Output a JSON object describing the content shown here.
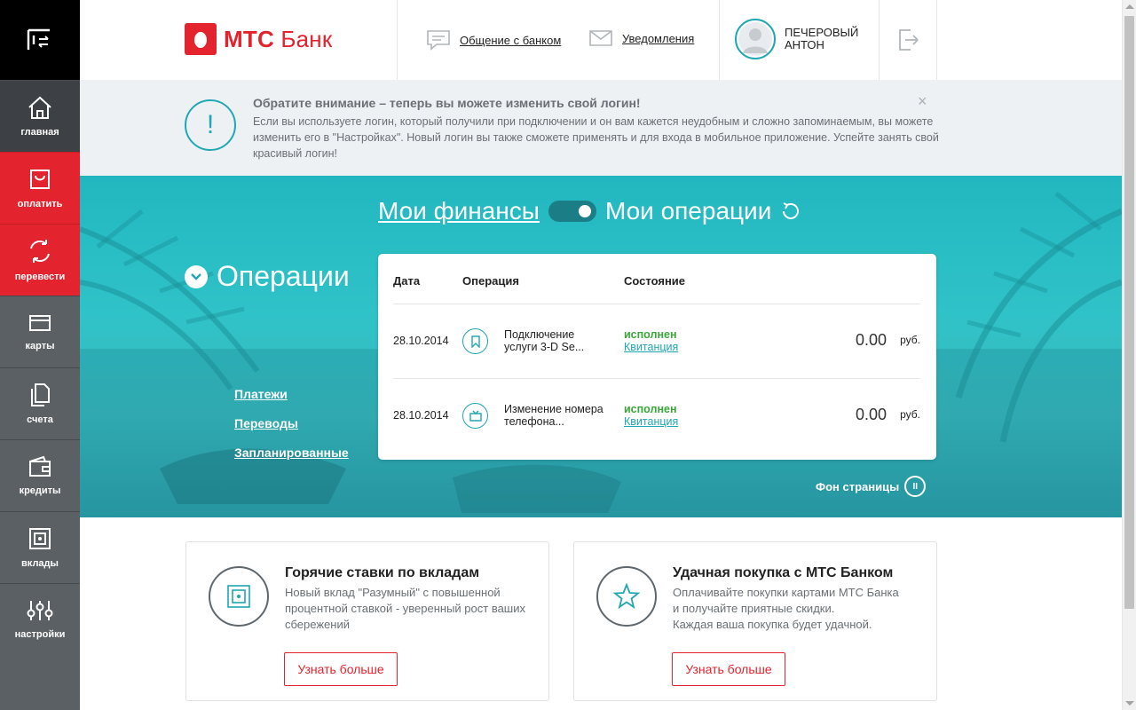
{
  "sidebar": {
    "items": [
      {
        "label": "главная"
      },
      {
        "label": "оплатить"
      },
      {
        "label": "перевести"
      },
      {
        "label": "карты"
      },
      {
        "label": "счета"
      },
      {
        "label": "кредиты"
      },
      {
        "label": "вклады"
      },
      {
        "label": "настройки"
      }
    ]
  },
  "header": {
    "brand_bold": "МТС",
    "brand_rest": " Банк",
    "chat_link": "Общение с банком",
    "notify_link": "Уведомления",
    "user_name_line1": "ПЕЧЕРОВЫЙ",
    "user_name_line2": "АНТОН"
  },
  "notice": {
    "icon": "!",
    "title": "Обратите внимание – теперь вы можете изменить свой логин!",
    "text": "Если вы используете логин, который получили при подключении и он вам кажется неудобным и сложно запоминаемым, вы можете изменить его в \"Настройках\". Новый логин вы также сможете применять и для входа в мобильное приложение. Успейте занять свой красивый логин!",
    "close": "×"
  },
  "hero": {
    "toggle_left": "Мои финансы",
    "toggle_right": "Мои операции",
    "ops_title": "Операции",
    "links": [
      "Платежи",
      "Переводы",
      "Запланированные"
    ],
    "bg_toggle": "Фон страницы",
    "bg_pause": "II"
  },
  "operations": {
    "headers": {
      "date": "Дата",
      "operation": "Операция",
      "state": "Состояние"
    },
    "rows": [
      {
        "date": "28.10.2014",
        "desc_line1": "Подключение",
        "desc_line2": "услуги 3-D Se...",
        "status": "исполнен",
        "receipt": "Квитанция",
        "amount": "0.00",
        "currency": "руб.",
        "icon": "bookmark-icon"
      },
      {
        "date": "28.10.2014",
        "desc_line1": "Изменение номера",
        "desc_line2": "телефона...",
        "status": "исполнен",
        "receipt": "Квитанция",
        "amount": "0.00",
        "currency": "руб.",
        "icon": "tv-icon"
      }
    ]
  },
  "promos": [
    {
      "title": "Горячие ставки по вкладам",
      "text": "Новый вклад \"Разумный\" с повышенной процентной ставкой - уверенный рост ваших сбережений",
      "button": "Узнать больше",
      "icon": "safe-icon"
    },
    {
      "title": "Удачная покупка с МТС Банком",
      "text_line1": "Оплачивайте покупки картами МТС Банка",
      "text_line2": "и получайте приятные скидки.",
      "text_line3": "Каждая ваша покупка будет удачной.",
      "button": "Узнать больше",
      "icon": "star-icon"
    }
  ],
  "colors": {
    "brand_red": "#e3232d",
    "accent_teal": "#21a7b4",
    "sidebar_gray": "#5b6064",
    "status_green": "#3aa63a"
  }
}
